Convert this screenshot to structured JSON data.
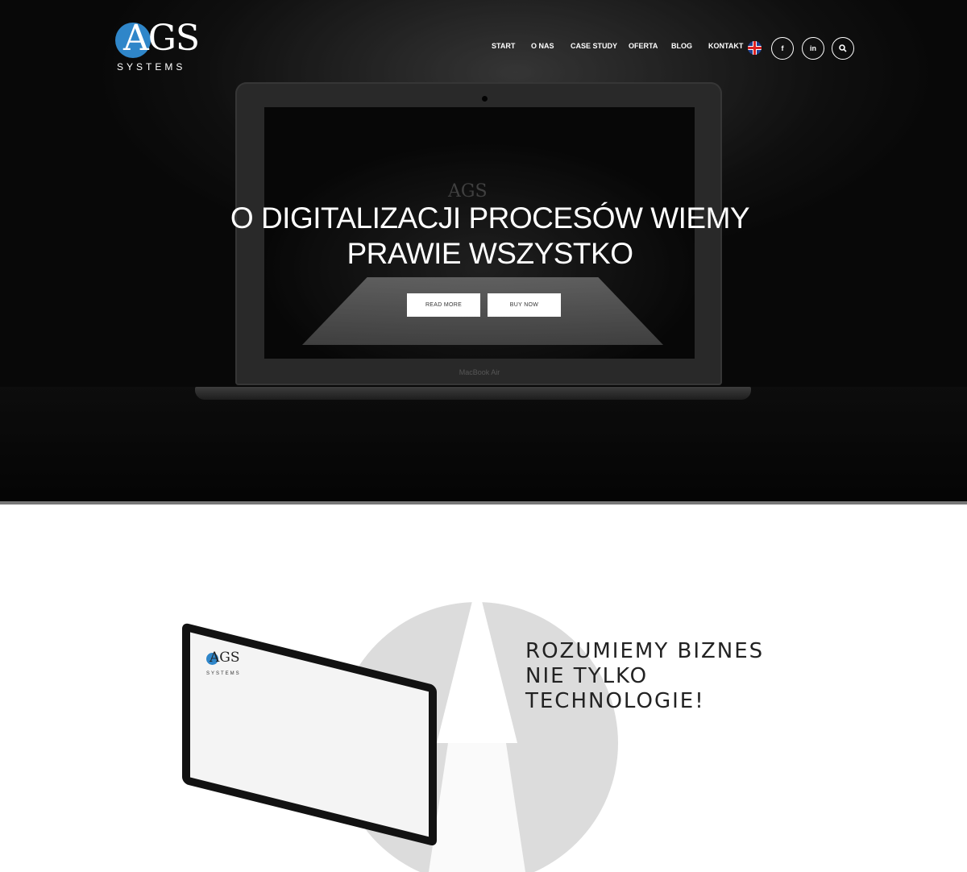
{
  "header": {
    "logo_text": "AGS",
    "logo_subtext": "SYSTEMS",
    "nav": [
      "START",
      "O NAS",
      "CASE STUDY",
      "OFERTA",
      "BLOG",
      "KONTAKT"
    ],
    "language_icon": "uk-flag-icon",
    "social": [
      {
        "label": "f",
        "icon": "facebook-icon"
      },
      {
        "label": "in",
        "icon": "linkedin-icon"
      }
    ],
    "search_icon": "search-icon"
  },
  "hero": {
    "title_line1": "O DIGITALIZACJI PROCESÓW WIEMY",
    "title_line2": "PRAWIE WSZYSTKO",
    "read_more": "READ MORE",
    "buy_now": "BUY NOW",
    "laptop_brand": "MacBook Air",
    "screen_logo": "AGS"
  },
  "about": {
    "line1": "ROZUMIEMY BIZNES",
    "line2": "NIE TYLKO",
    "line3": "TECHNOLOGIE!",
    "monitor_logo_text": "AGS",
    "monitor_logo_subtext": "SYSTEMS"
  },
  "colors": {
    "brand_blue": "#2f86c9",
    "hero_dark": "#0c0c0c",
    "text_dark": "#222222"
  }
}
